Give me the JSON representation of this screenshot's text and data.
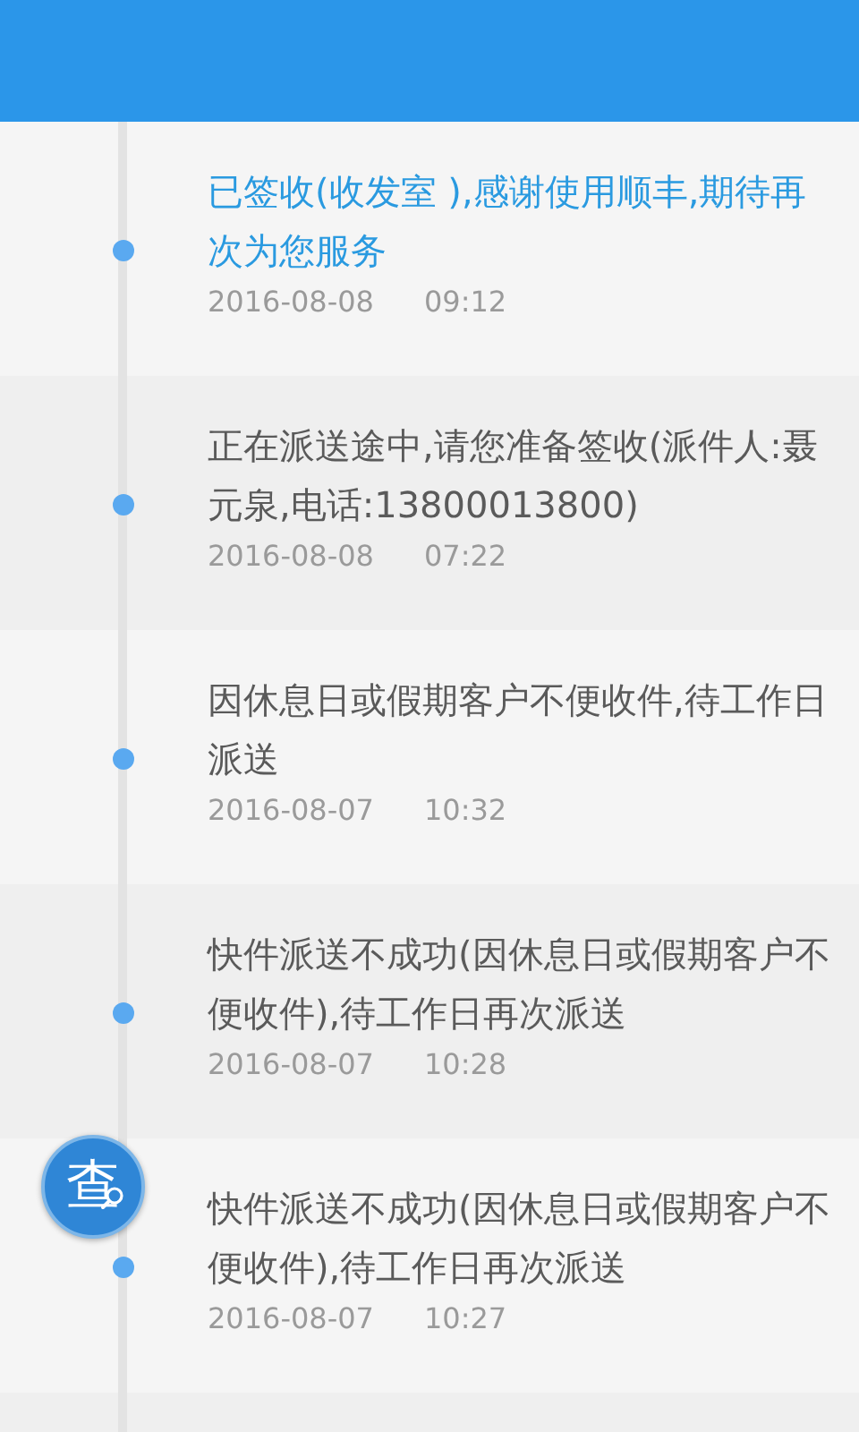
{
  "events": [
    {
      "text": "已签收(收发室 ),感谢使用顺丰,期待再次为您服务",
      "date": "2016-08-08",
      "time": "09:12",
      "current": true
    },
    {
      "text": "正在派送途中,请您准备签收(派件人:聂元泉,电话:13800013800)",
      "date": "2016-08-08",
      "time": "07:22",
      "current": false
    },
    {
      "text": "因休息日或假期客户不便收件,待工作日派送",
      "date": "2016-08-07",
      "time": "10:32",
      "current": false
    },
    {
      "text": "快件派送不成功(因休息日或假期客户不便收件),待工作日再次派送",
      "date": "2016-08-07",
      "time": "10:28",
      "current": false
    },
    {
      "text": "快件派送不成功(因休息日或假期客户不便收件),待工作日再次派送",
      "date": "2016-08-07",
      "time": "10:27",
      "current": false
    }
  ],
  "fab": {
    "label": "查"
  }
}
